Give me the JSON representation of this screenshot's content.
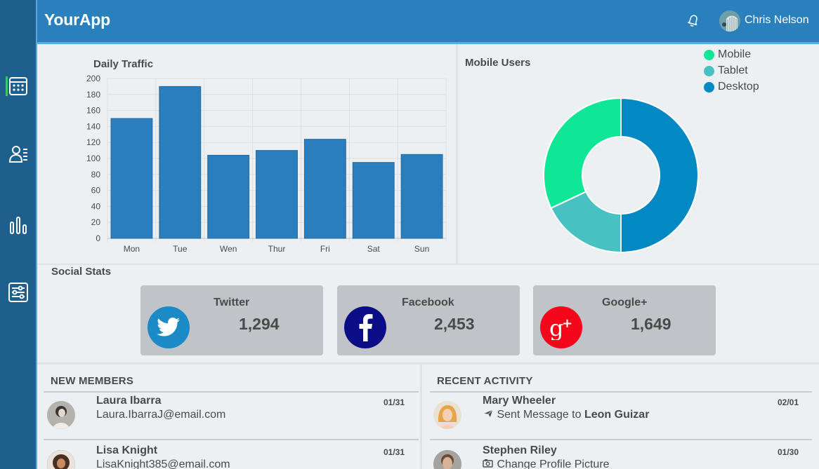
{
  "app": {
    "title": "YourApp"
  },
  "header": {
    "user_name": "Chris Nelson"
  },
  "sidebar": {
    "items": [
      {
        "icon": "calendar-icon",
        "active": true
      },
      {
        "icon": "users-list-icon",
        "active": false
      },
      {
        "icon": "bar-chart-icon",
        "active": false
      },
      {
        "icon": "settings-sliders-icon",
        "active": false
      }
    ]
  },
  "traffic": {
    "title": "Daily Traffic",
    "chart_data": {
      "type": "bar",
      "title": "Daily Traffic",
      "categories": [
        "Mon",
        "Tue",
        "Wen",
        "Thur",
        "Fri",
        "Sat",
        "Sun"
      ],
      "values": [
        150,
        190,
        104,
        110,
        124,
        95,
        105
      ],
      "ylim": [
        0,
        200
      ],
      "yticks": [
        0,
        20,
        40,
        60,
        80,
        100,
        120,
        140,
        160,
        180,
        200
      ],
      "color": "#2a7ebd",
      "grid": true
    }
  },
  "mobile": {
    "title": "Mobile Users",
    "chart_data": {
      "type": "pie",
      "labels": [
        "Mobile",
        "Tablet",
        "Desktop"
      ],
      "values": [
        32,
        18,
        50
      ],
      "colors": [
        "#0fe696",
        "#47c1c1",
        "#0289c4"
      ],
      "legend": "top-right",
      "donut": true
    }
  },
  "social": {
    "title": "Social Stats",
    "cards": [
      {
        "name": "Twitter",
        "count": "1,294",
        "color": "#1b8ac6",
        "icon": "twitter-icon"
      },
      {
        "name": "Facebook",
        "count": "2,453",
        "color": "#0a0d86",
        "icon": "facebook-icon"
      },
      {
        "name": "Google+",
        "count": "1,649",
        "color": "#f5071b",
        "icon": "google-plus-icon"
      }
    ]
  },
  "members": {
    "heading": "NEW MEMBERS",
    "rows": [
      {
        "name": "Laura Ibarra",
        "sub": "Laura.IbarraJ@email.com",
        "date": "01/31"
      },
      {
        "name": "Lisa Knight",
        "sub": "LisaKnight385@email.com",
        "date": "01/31"
      }
    ]
  },
  "activity": {
    "heading": "RECENT ACTIVITY",
    "rows": [
      {
        "name": "Mary Wheeler",
        "action": "Sent Message to ",
        "target": "Leon Guizar",
        "date": "02/01",
        "icon": "send-icon"
      },
      {
        "name": "Stephen Riley",
        "action": "Change Profile Picture",
        "target": "",
        "date": "01/30",
        "icon": "camera-icon"
      }
    ]
  }
}
